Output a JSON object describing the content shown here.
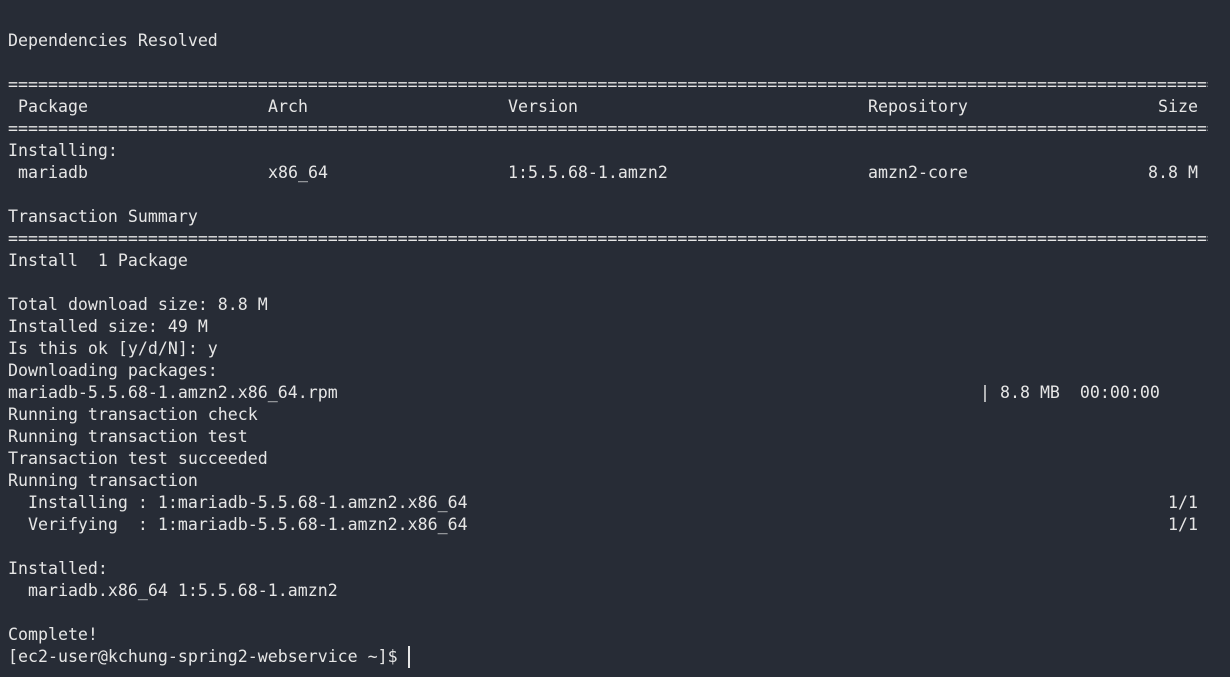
{
  "terminal": {
    "deps_resolved": "Dependencies Resolved",
    "separator": "==================================================================================================================================",
    "header": {
      "package": "Package",
      "arch": "Arch",
      "version": "Version",
      "repository": "Repository",
      "size": "Size"
    },
    "installing_label": "Installing:",
    "package_row": {
      "package": "mariadb",
      "arch": "x86_64",
      "version": "1:5.5.68-1.amzn2",
      "repository": "amzn2-core",
      "size": "8.8 M"
    },
    "transaction_summary": "Transaction Summary",
    "install_count": "Install  1 Package",
    "total_download": "Total download size: 8.8 M",
    "installed_size": "Installed size: 49 M",
    "prompt_question": "Is this ok [y/d/N]: y",
    "downloading": "Downloading packages:",
    "rpm_file": "mariadb-5.5.68-1.amzn2.x86_64.rpm",
    "rpm_progress": "| 8.8 MB  00:00:00",
    "check": "Running transaction check",
    "test": "Running transaction test",
    "succeeded": "Transaction test succeeded",
    "running": "Running transaction",
    "installing_step": "  Installing : 1:mariadb-5.5.68-1.amzn2.x86_64",
    "installing_count": "1/1",
    "verifying_step": "  Verifying  : 1:mariadb-5.5.68-1.amzn2.x86_64",
    "verifying_count": "1/1",
    "installed_label": "Installed:",
    "installed_pkg": "  mariadb.x86_64 1:5.5.68-1.amzn2",
    "complete": "Complete!",
    "prompt": "[ec2-user@kchung-spring2-webservice ~]$ "
  }
}
